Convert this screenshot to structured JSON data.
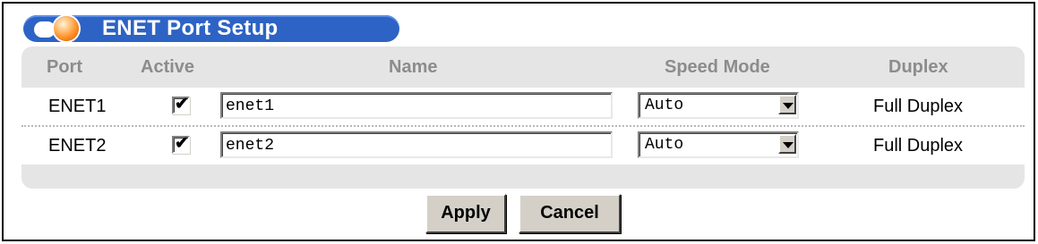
{
  "section": {
    "title": "ENET Port Setup"
  },
  "table": {
    "headers": {
      "port": "Port",
      "active": "Active",
      "name": "Name",
      "speed_mode": "Speed Mode",
      "duplex": "Duplex"
    },
    "rows": [
      {
        "port": "ENET1",
        "active": true,
        "active_mark": "✔",
        "name": "enet1",
        "speed_mode": "Auto",
        "duplex": "Full Duplex"
      },
      {
        "port": "ENET2",
        "active": true,
        "active_mark": "✔",
        "name": "enet2",
        "speed_mode": "Auto",
        "duplex": "Full Duplex"
      }
    ]
  },
  "buttons": {
    "apply": "Apply",
    "cancel": "Cancel"
  },
  "colors": {
    "title_bar": "#2d63c4",
    "panel": "#e5e5e5",
    "header_text": "#8c8c8c",
    "orb": "#ff8a1e"
  }
}
